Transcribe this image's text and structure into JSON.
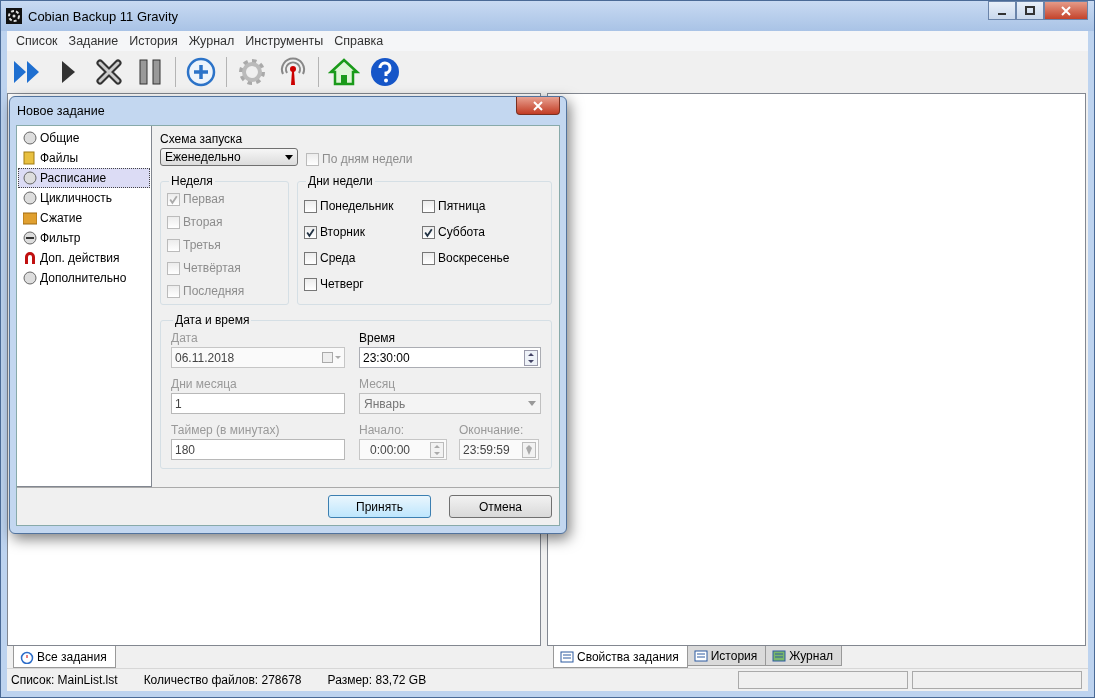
{
  "window": {
    "title": "Cobian Backup 11 Gravity"
  },
  "menu": [
    "Список",
    "Задание",
    "История",
    "Журнал",
    "Инструменты",
    "Справка"
  ],
  "left_tabs": [
    {
      "label": "Все задания",
      "selected": true
    }
  ],
  "right_tabs": [
    {
      "label": "Свойства задания",
      "selected": true
    },
    {
      "label": "История",
      "selected": false
    },
    {
      "label": "Журнал",
      "selected": false
    }
  ],
  "status_bar": [
    "Список: MainList.lst",
    "Количество файлов: 278678",
    "Размер: 83,72 GB"
  ],
  "dialog": {
    "title": "Новое задание",
    "nav": [
      {
        "label": "Общие",
        "selected": false
      },
      {
        "label": "Файлы",
        "selected": false
      },
      {
        "label": "Расписание",
        "selected": true
      },
      {
        "label": "Цикличность",
        "selected": false
      },
      {
        "label": "Сжатие",
        "selected": false
      },
      {
        "label": "Фильтр",
        "selected": false
      },
      {
        "label": "Доп. действия",
        "selected": false
      },
      {
        "label": "Дополнительно",
        "selected": false
      }
    ],
    "schedule": {
      "label": "Схема запуска",
      "value": "Еженедельно"
    },
    "by_weekdays": {
      "label": "По дням недели",
      "checked": false,
      "disabled": true
    },
    "week": {
      "title": "Неделя",
      "items": [
        {
          "label": "Первая",
          "checked": true,
          "disabled": true
        },
        {
          "label": "Вторая",
          "checked": false,
          "disabled": true
        },
        {
          "label": "Третья",
          "checked": false,
          "disabled": true
        },
        {
          "label": "Четвёртая",
          "checked": false,
          "disabled": true
        },
        {
          "label": "Последняя",
          "checked": false,
          "disabled": true
        }
      ]
    },
    "weekdays": {
      "title": "Дни недели",
      "items": [
        {
          "label": "Понедельник",
          "checked": false,
          "disabled": false
        },
        {
          "label": "Пятница",
          "checked": false,
          "disabled": false
        },
        {
          "label": "Вторник",
          "checked": true,
          "disabled": false
        },
        {
          "label": "Суббота",
          "checked": true,
          "disabled": false
        },
        {
          "label": "Среда",
          "checked": false,
          "disabled": false
        },
        {
          "label": "Воскресенье",
          "checked": false,
          "disabled": false
        },
        {
          "label": "Четверг",
          "checked": false,
          "disabled": false
        }
      ]
    },
    "datetime": {
      "title": "Дата и время",
      "date": {
        "label": "Дата",
        "value": "06.11.2018",
        "disabled": true
      },
      "time": {
        "label": "Время",
        "value": "23:30:00",
        "disabled": false
      },
      "month_days": {
        "label": "Дни месяца",
        "value": "1",
        "disabled": true
      },
      "month": {
        "label": "Месяц",
        "value": "Январь",
        "disabled": true
      },
      "timer": {
        "label": "Таймер (в минутах)",
        "value": "180",
        "disabled": true
      },
      "start": {
        "label": "Начало:",
        "value": "0:00:00",
        "disabled": true
      },
      "end": {
        "label": "Окончание:",
        "value": "23:59:59",
        "disabled": true
      }
    },
    "buttons": [
      {
        "label": "Принять",
        "default": true
      },
      {
        "label": "Отмена",
        "default": false
      }
    ]
  }
}
